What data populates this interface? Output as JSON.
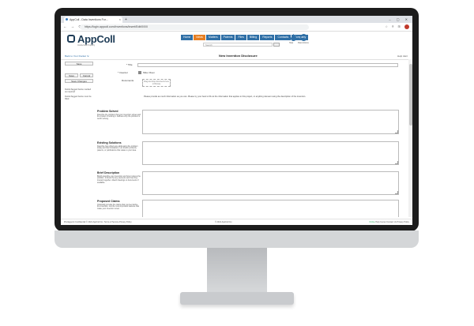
{
  "browser": {
    "tab_title": "AppColl - Data Inventions For...",
    "tab_close": "×",
    "new_tab": "+",
    "window_controls": "–  ▢  ✕",
    "nav_buttons": "←  →  ⟳",
    "url": "https://login.appcoll.com/Inventions/Insert/Edit/0/0/0",
    "ext_icons": "☆  ⌾  ⊞"
  },
  "app": {
    "logo_text": "AppColl",
    "logo_sub": "Intellectual Property",
    "nav": [
      {
        "label": "Home",
        "active": false
      },
      {
        "label": "Ideas",
        "active": true
      },
      {
        "label": "Matters",
        "active": false
      },
      {
        "label": "Patents",
        "active": false
      },
      {
        "label": "Files",
        "active": false
      },
      {
        "label": "Billing",
        "active": false
      },
      {
        "label": "Reports",
        "active": false
      },
      {
        "label": "Contacts",
        "active": false
      },
      {
        "label": "Company",
        "active": false
      }
    ],
    "search_placeholder": "Search",
    "header_icons": [
      {
        "name": "drop-icon",
        "label": "Help"
      },
      {
        "name": "clock-icon",
        "label": "Past Actions"
      }
    ]
  },
  "pagebar": {
    "back_link": "Back to Your Docket ⇲",
    "title": "New Invention Disclosure",
    "help_links": "Help  Alert"
  },
  "sidebar": {
    "save": "Save",
    "save_new": "Save",
    "cancel": "Cancel",
    "save_changes": "Save Changes",
    "note1": "Fields flagged below marked as required",
    "note2": "Fields flagged below must be filled"
  },
  "form": {
    "title_label": "* Title",
    "inventor_label": "* Inventor",
    "inventor_value": "Mike Olsen",
    "documents_label": "Documents",
    "documents_drop": "Drag and drop documents here or Browse",
    "instructions": "Please provide as much information as you can. Please try your best to fill out the information that applies to this project, or anything relevant using the description of the invention.",
    "sections": [
      {
        "heading": "Problem Solved",
        "desc": "Describe the problem that your invention solves and the impact of solving it. Address why the problem is worth solving."
      },
      {
        "heading": "Existing Solutions",
        "desc": "Describe how others are addressing the problem today and their limitations. List known products, patents, or publications that relate to your idea."
      },
      {
        "heading": "Brief Description",
        "desc": "Briefly describe your invention and how it solves the problem. Include the key elements and how they interact together. Attach drawings or documents if available."
      },
      {
        "heading": "Proposed Claims",
        "desc": "Optionally provide the claims that you feel define the invention. List the most important features that make your invention novel."
      }
    ]
  },
  "footer": {
    "left": "Privileged & Confidential  © 2021 AppColl Inc.  Terms of Service  Privacy Policy",
    "center": "© 2021 AppColl Inc.",
    "right_status": "Online",
    "right_rest": "Help Center  Contact Us  Privacy Policy"
  }
}
